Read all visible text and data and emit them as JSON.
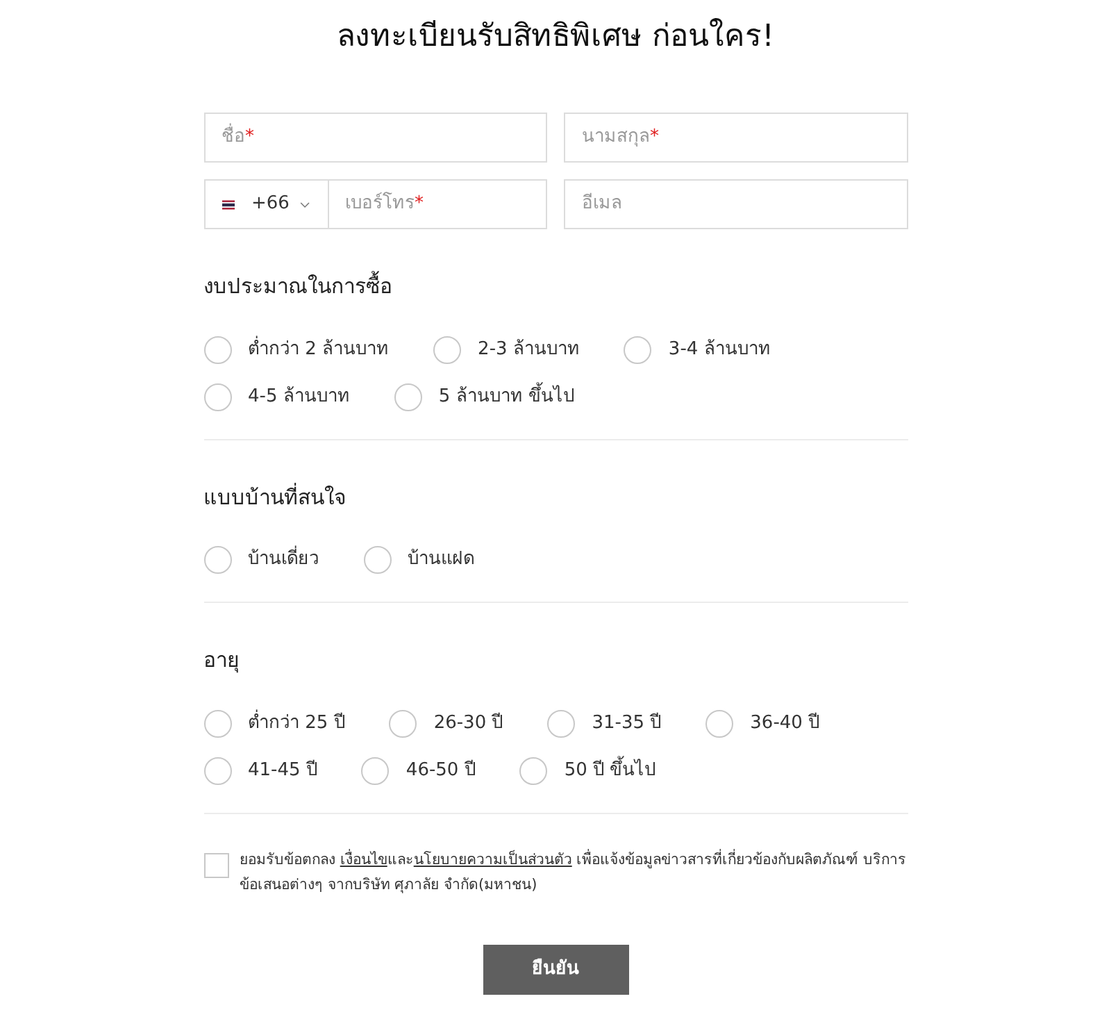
{
  "title": "ลงทะเบียนรับสิทธิพิเศษ ก่อนใคร!",
  "fields": {
    "first_name": {
      "placeholder": "ชื่อ",
      "required_mark": "*"
    },
    "last_name": {
      "placeholder": "นามสกุล",
      "required_mark": "*"
    },
    "country_code": {
      "value": "+66"
    },
    "phone": {
      "placeholder": "เบอร์โทร",
      "required_mark": "*"
    },
    "email": {
      "placeholder": "อีเมล"
    }
  },
  "groups": [
    {
      "heading": "งบประมาณในการซื้อ",
      "options": [
        {
          "label": "ต่ำกว่า 2 ล้านบาท",
          "selected": false
        },
        {
          "label": "2-3 ล้านบาท",
          "selected": false
        },
        {
          "label": "3-4 ล้านบาท",
          "selected": false
        },
        {
          "label": "4-5 ล้านบาท",
          "selected": false
        },
        {
          "label": "5 ล้านบาท ขึ้นไป",
          "selected": false
        }
      ]
    },
    {
      "heading": "แบบบ้านที่สนใจ",
      "options": [
        {
          "label": "บ้านเดี่ยว",
          "selected": false
        },
        {
          "label": "บ้านแฝด",
          "selected": false
        }
      ]
    },
    {
      "heading": "อายุ",
      "options": [
        {
          "label": "ต่ำกว่า 25 ปี",
          "selected": false
        },
        {
          "label": "26-30 ปี",
          "selected": false
        },
        {
          "label": "31-35 ปี",
          "selected": false
        },
        {
          "label": "36-40 ปี",
          "selected": false
        },
        {
          "label": "41-45 ปี",
          "selected": false
        },
        {
          "label": "46-50 ปี",
          "selected": false
        },
        {
          "label": "50 ปี ขึ้นไป",
          "selected": false
        }
      ]
    }
  ],
  "consent": {
    "checked": false,
    "parts": [
      {
        "kind": "text",
        "text": "ยอมรับข้อตกลง "
      },
      {
        "kind": "link",
        "text": "เงื่อนไข"
      },
      {
        "kind": "text",
        "text": "และ"
      },
      {
        "kind": "link",
        "text": "นโยบายความเป็นส่วนตัว"
      },
      {
        "kind": "text",
        "text": " เพื่อแจ้งข้อมูลข่าวสารที่เกี่ยวข้องกับผลิตภัณฑ์ บริการ ข้อเสนอต่างๆ จากบริษัท ศุภาลัย จำกัด(มหาชน)"
      }
    ]
  },
  "submit": {
    "label": "ยืนยัน"
  }
}
